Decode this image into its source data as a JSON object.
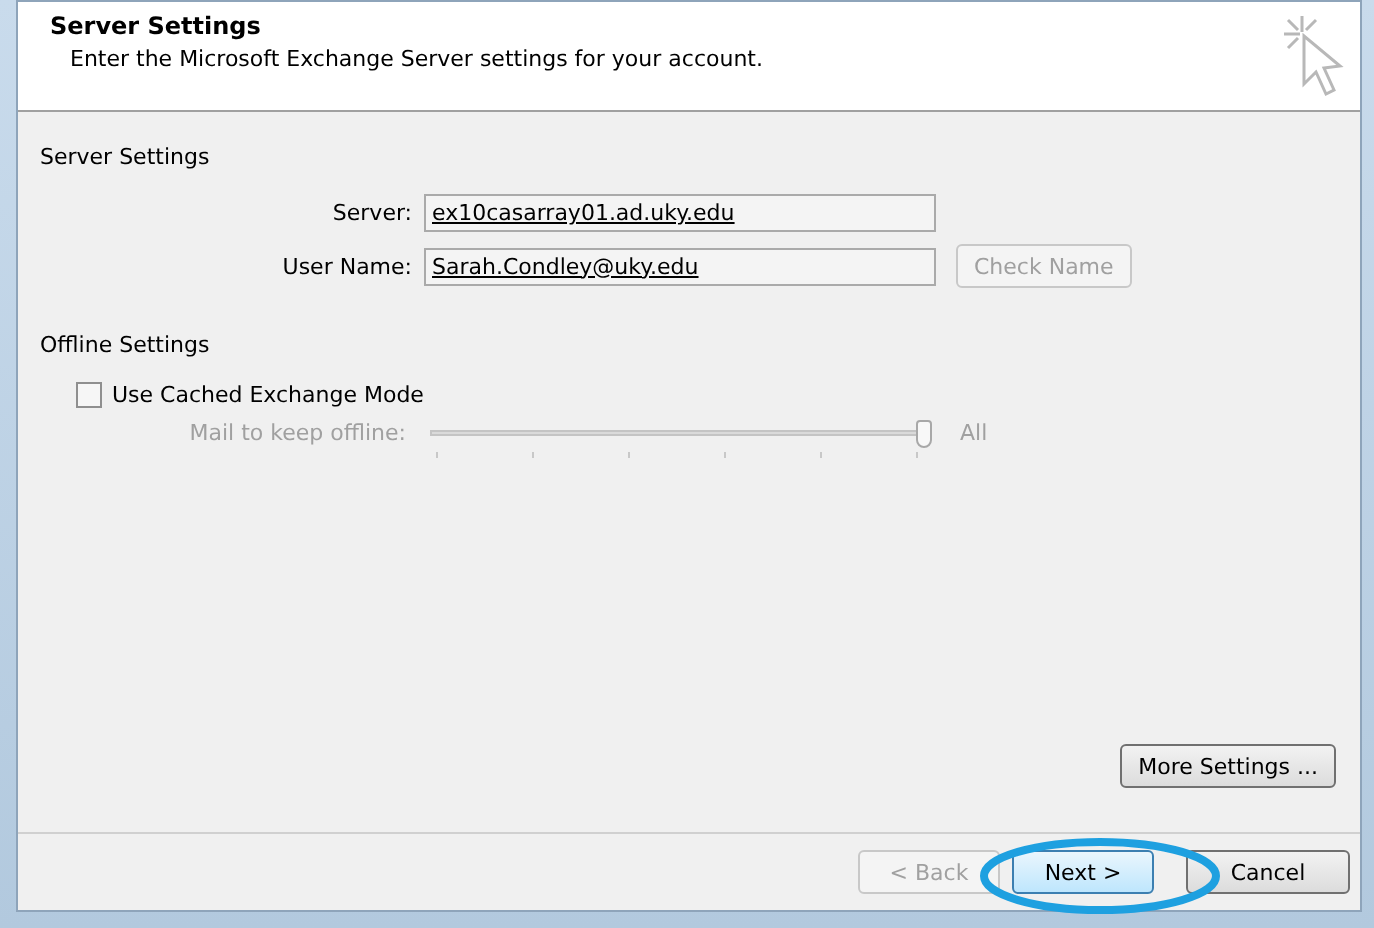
{
  "header": {
    "title": "Server Settings",
    "subtitle": "Enter the Microsoft Exchange Server settings for your account."
  },
  "server_settings": {
    "heading": "Server Settings",
    "fields": [
      {
        "label": "Server:",
        "value": "ex10casarray01.ad.uky.edu"
      },
      {
        "label": "User Name:",
        "value": "Sarah.Condley@uky.edu"
      }
    ],
    "check_name": {
      "label": "Check Name",
      "disabled": true
    }
  },
  "offline_settings": {
    "heading": "Offline Settings",
    "cached_mode": {
      "label": "Use Cached Exchange Mode",
      "checked": false
    },
    "slider": {
      "label": "Mail to keep offline:",
      "level": 1,
      "reading": "All",
      "disabled": true
    }
  },
  "more_settings": {
    "label": "More Settings ..."
  },
  "buttons": [
    {
      "label": "< Back",
      "disabled": true,
      "highlighted": false
    },
    {
      "label": "Next >",
      "disabled": false,
      "highlighted": true
    },
    {
      "label": "Cancel",
      "disabled": false,
      "highlighted": false
    }
  ]
}
